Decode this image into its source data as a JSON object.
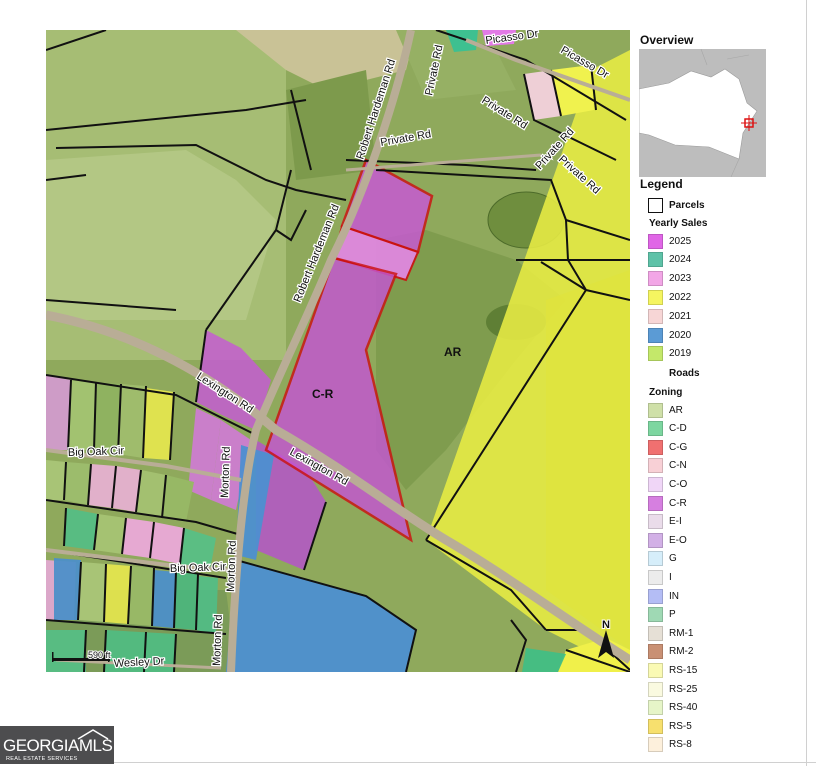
{
  "map": {
    "roads": {
      "robert_hardeman_upper": "Robert Hardeman Rd",
      "robert_hardeman_lower": "Robert Hardeman Rd",
      "lexington_west": "Lexington Rd",
      "lexington_east": "Lexington Rd",
      "private_1": "Private Rd",
      "private_2": "Private Rd",
      "private_3": "Private Rd",
      "private_4": "Private Rd",
      "private_5": "Private Rd",
      "private_6": "Private Rd",
      "picasso_1": "Picasso Dr",
      "picasso_2": "Picasso Dr",
      "big_oak_1": "Big Oak Cir",
      "big_oak_2": "Big Oak Cir",
      "morton_1": "Morton Rd",
      "morton_2": "Morton Rd",
      "morton_3": "Morton Rd",
      "wesley": "Wesley Dr"
    },
    "zones": {
      "ar": "AR",
      "cr": "C-R"
    },
    "scale": "590 ft",
    "north": "N"
  },
  "overview": {
    "title": "Overview"
  },
  "legend": {
    "title": "Legend",
    "parcels_label": "Parcels",
    "yearly_sales_heading": "Yearly Sales",
    "yearly_sales": [
      {
        "label": "2025",
        "color": "#e066e6"
      },
      {
        "label": "2024",
        "color": "#5ec2a8"
      },
      {
        "label": "2023",
        "color": "#f2a6e6"
      },
      {
        "label": "2022",
        "color": "#f5f560"
      },
      {
        "label": "2021",
        "color": "#f7d6d6"
      },
      {
        "label": "2020",
        "color": "#5b9bd5"
      },
      {
        "label": "2019",
        "color": "#c4e86a"
      }
    ],
    "roads_heading": "Roads",
    "zoning_heading": "Zoning",
    "zoning": [
      {
        "label": "AR",
        "color": "#cfe0a8"
      },
      {
        "label": "C-D",
        "color": "#7dd6a0"
      },
      {
        "label": "C-G",
        "color": "#f07070"
      },
      {
        "label": "C-N",
        "color": "#f8d0d6"
      },
      {
        "label": "C-O",
        "color": "#f0d6f7"
      },
      {
        "label": "C-R",
        "color": "#d67fe0"
      },
      {
        "label": "E-I",
        "color": "#eadcea"
      },
      {
        "label": "E-O",
        "color": "#d2b0e6"
      },
      {
        "label": "G",
        "color": "#d6eefa"
      },
      {
        "label": "I",
        "color": "#ececec"
      },
      {
        "label": "IN",
        "color": "#b4bdf5"
      },
      {
        "label": "P",
        "color": "#9fd9b4"
      },
      {
        "label": "RM-1",
        "color": "#e6e0d6"
      },
      {
        "label": "RM-2",
        "color": "#c99074"
      },
      {
        "label": "RS-15",
        "color": "#fafab4"
      },
      {
        "label": "RS-25",
        "color": "#fafae0"
      },
      {
        "label": "RS-40",
        "color": "#e6f5c8"
      },
      {
        "label": "RS-5",
        "color": "#f7e06e"
      },
      {
        "label": "RS-8",
        "color": "#fdf0dc"
      }
    ]
  },
  "logo": {
    "name": "GEORGIAMLS",
    "tagline": "REAL ESTATE SERVICES"
  }
}
